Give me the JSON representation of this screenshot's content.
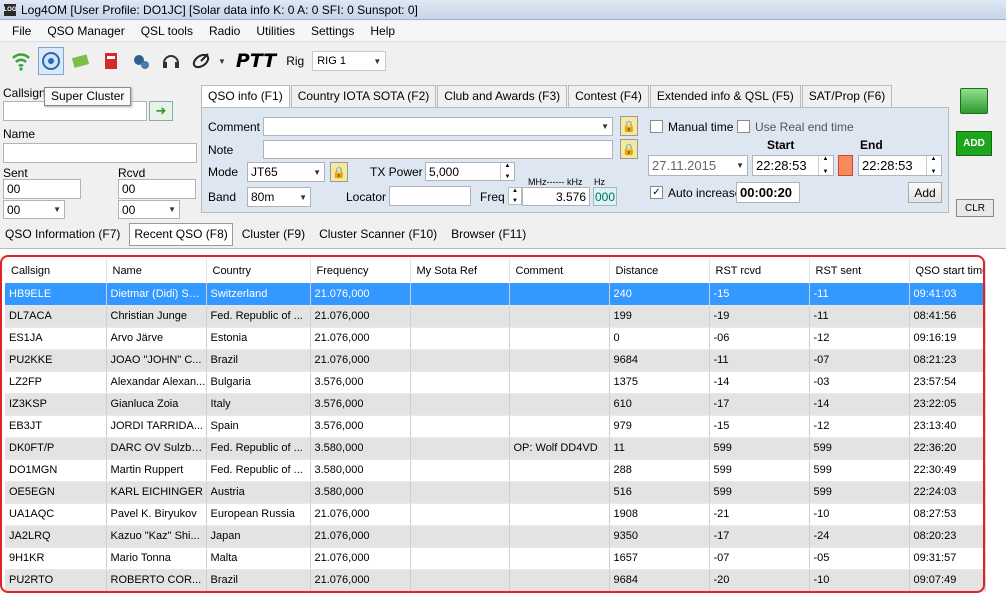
{
  "window": {
    "app_icon": "LOG",
    "title": "Log4OM [User Profile: DO1JC] [Solar data info K: 0 A: 0 SFI: 0 Sunspot: 0]"
  },
  "menu": [
    "File",
    "QSO Manager",
    "QSL tools",
    "Radio",
    "Utilities",
    "Settings",
    "Help"
  ],
  "toolbar": {
    "ptt": "PTT",
    "rig_label": "Rig",
    "rig_value": "RIG 1",
    "tooltip": "Super Cluster"
  },
  "left": {
    "callsign_label": "Callsign",
    "callsign_value": "",
    "name_label": "Name",
    "name_value": "",
    "sent_label": "Sent",
    "rcvd_label": "Rcvd",
    "sent_value": "00",
    "rcvd_value": "00",
    "sent_combo": "00",
    "rcvd_combo": "00"
  },
  "top_tabs": [
    "QSO info (F1)",
    "Country IOTA SOTA (F2)",
    "Club and Awards (F3)",
    "Contest (F4)",
    "Extended info & QSL (F5)",
    "SAT/Prop (F6)"
  ],
  "qso": {
    "comment_label": "Comment",
    "comment_value": "",
    "note_label": "Note",
    "note_value": "",
    "mode_label": "Mode",
    "mode_value": "JT65",
    "band_label": "Band",
    "band_value": "80m",
    "txpower_label": "TX Power",
    "txpower_value": "5,000",
    "locator_label": "Locator",
    "locator_value": "",
    "freq_label": "Freq",
    "freq_unit": "MHz------ kHz",
    "freq_hz_label": "Hz",
    "freq_value": "3.576",
    "freq_hz": "000",
    "manual_time": "Manual time",
    "use_real_end": "Use Real end time",
    "start_label": "Start",
    "end_label": "End",
    "date": "27.11.2015",
    "start_time": "22:28:53",
    "end_time": "22:28:53",
    "auto_increase": "Auto increase",
    "duration": "00:00:20",
    "add_button": "Add"
  },
  "right": {
    "add_label": "ADD",
    "clr_label": "CLR"
  },
  "bottom_tabs": [
    "QSO Information (F7)",
    "Recent QSO (F8)",
    "Cluster (F9)",
    "Cluster Scanner (F10)",
    "Browser (F11)"
  ],
  "grid": {
    "columns": [
      "Callsign",
      "Name",
      "Country",
      "Frequency",
      "My Sota Ref",
      "Comment",
      "Distance",
      "RST rcvd",
      "RST sent",
      "QSO start time"
    ],
    "rows": [
      [
        "HB9ELE",
        "Dietmar (Didi) Seiss",
        "Switzerland",
        "21.076,000",
        "",
        "",
        "240",
        "-15",
        "-11",
        "09:41:03"
      ],
      [
        "DL7ACA",
        "Christian Junge",
        "Fed. Republic of ...",
        "21.076,000",
        "",
        "",
        "199",
        "-19",
        "-11",
        "08:41:56"
      ],
      [
        "ES1JA",
        "Arvo Järve",
        "Estonia",
        "21.076,000",
        "",
        "",
        "0",
        "-06",
        "-12",
        "09:16:19"
      ],
      [
        "PU2KKE",
        "JOAO \"JOHN\" C...",
        "Brazil",
        "21.076,000",
        "",
        "",
        "9684",
        "-11",
        "-07",
        "08:21:23"
      ],
      [
        "LZ2FP",
        "Alexandar Alexan...",
        "Bulgaria",
        "3.576,000",
        "",
        "",
        "1375",
        "-14",
        "-03",
        "23:57:54"
      ],
      [
        "IZ3KSP",
        "Gianluca Zoia",
        "Italy",
        "3.576,000",
        "",
        "",
        "610",
        "-17",
        "-14",
        "23:22:05"
      ],
      [
        "EB3JT",
        "JORDI TARRIDA...",
        "Spain",
        "3.576,000",
        "",
        "",
        "979",
        "-15",
        "-12",
        "23:13:40"
      ],
      [
        "DK0FT/P",
        "DARC OV Sulzba...",
        "Fed. Republic of ...",
        "3.580,000",
        "",
        "OP: Wolf DD4VD",
        "11",
        "599",
        "599",
        "22:36:20"
      ],
      [
        "DO1MGN",
        "Martin Ruppert",
        "Fed. Republic of ...",
        "3.580,000",
        "",
        "",
        "288",
        "599",
        "599",
        "22:30:49"
      ],
      [
        "OE5EGN",
        "KARL EICHINGER",
        "Austria",
        "3.580,000",
        "",
        "",
        "516",
        "599",
        "599",
        "22:24:03"
      ],
      [
        "UA1AQC",
        "Pavel K. Biryukov",
        "European Russia",
        "21.076,000",
        "",
        "",
        "1908",
        "-21",
        "-10",
        "08:27:53"
      ],
      [
        "JA2LRQ",
        "Kazuo \"Kaz\" Shi...",
        "Japan",
        "21.076,000",
        "",
        "",
        "9350",
        "-17",
        "-24",
        "08:20:23"
      ],
      [
        "9H1KR",
        "Mario Tonna",
        "Malta",
        "21.076,000",
        "",
        "",
        "1657",
        "-07",
        "-05",
        "09:31:57"
      ],
      [
        "PU2RTO",
        "ROBERTO COR...",
        "Brazil",
        "21.076,000",
        "",
        "",
        "9684",
        "-20",
        "-10",
        "09:07:49"
      ]
    ]
  }
}
